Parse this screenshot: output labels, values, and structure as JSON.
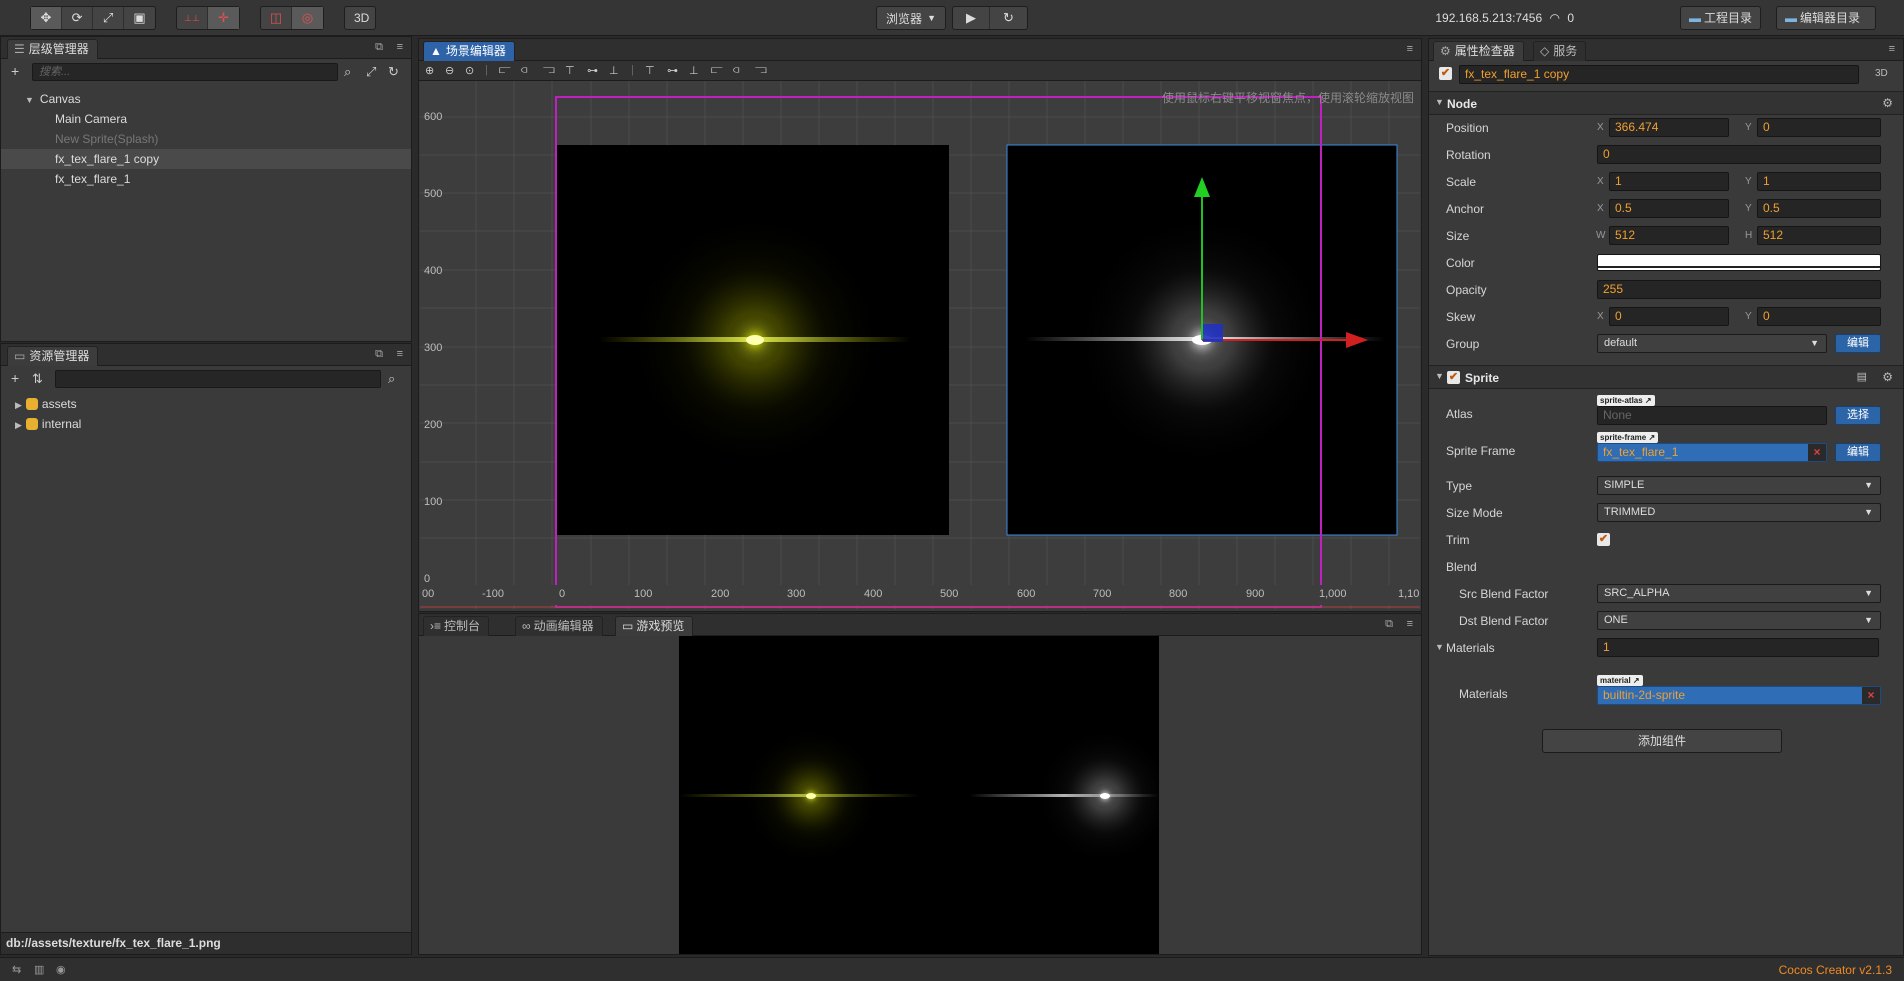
{
  "toolbar": {
    "transform_tools": [
      "move-tool-icon",
      "rotate-tool-icon",
      "scale-tool-icon",
      "rect-tool-icon"
    ],
    "gizmo_tools": [
      "pivot-icon",
      "world-local-icon"
    ],
    "snap_tools": [
      "snap-icon",
      "grid-icon"
    ],
    "mode_3d_label": "3D",
    "browser_select_label": "浏览器",
    "play_icon": "play-icon",
    "refresh_icon": "refresh-icon",
    "ip_address": "192.168.5.213:7456",
    "connections": "0",
    "project_dir_label": "工程目录",
    "editor_dir_label": "编辑器目录"
  },
  "hierarchy": {
    "tab_label": "层级管理器",
    "search_placeholder": "搜索...",
    "root": "Canvas",
    "items": [
      {
        "label": "Main Camera",
        "state": "normal"
      },
      {
        "label": "New Sprite(Splash)",
        "state": "inactive"
      },
      {
        "label": "fx_tex_flare_1 copy",
        "state": "selected"
      },
      {
        "label": "fx_tex_flare_1",
        "state": "normal"
      }
    ]
  },
  "assets": {
    "tab_label": "资源管理器",
    "search_placeholder": "",
    "items": [
      {
        "label": "assets"
      },
      {
        "label": "internal"
      }
    ],
    "footer_path": "db://assets/texture/fx_tex_flare_1.png"
  },
  "scene": {
    "tab_label": "场景编辑器",
    "hint": "使用鼠标右键平移视窗焦点，使用滚轮缩放视图",
    "y_ticks": [
      "600",
      "500",
      "400",
      "300",
      "200",
      "100",
      "0"
    ],
    "x_ticks": [
      "00",
      "-100",
      "0",
      "100",
      "200",
      "300",
      "400",
      "500",
      "600",
      "700",
      "800",
      "900",
      "1,000",
      "1,10"
    ]
  },
  "bottom_tabs": {
    "console": "控制台",
    "animation": "动画编辑器",
    "preview": "游戏预览"
  },
  "inspector": {
    "tab_label": "属性检查器",
    "services_tab": "服务",
    "node_name": "fx_tex_flare_1 copy",
    "mode_3d": "3D",
    "node_section": "Node",
    "position": {
      "label": "Position",
      "x": "366.474",
      "y": "0"
    },
    "rotation": {
      "label": "Rotation",
      "value": "0"
    },
    "scale": {
      "label": "Scale",
      "x": "1",
      "y": "1"
    },
    "anchor": {
      "label": "Anchor",
      "x": "0.5",
      "y": "0.5"
    },
    "size": {
      "label": "Size",
      "w": "512",
      "h": "512"
    },
    "color": {
      "label": "Color",
      "value": "#ffffff"
    },
    "opacity": {
      "label": "Opacity",
      "value": "255"
    },
    "skew": {
      "label": "Skew",
      "x": "0",
      "y": "0"
    },
    "group": {
      "label": "Group",
      "value": "default",
      "edit": "编辑"
    },
    "sprite_section": "Sprite",
    "atlas": {
      "label": "Atlas",
      "tag": "sprite-atlas",
      "value": "None",
      "button": "选择"
    },
    "sprite_frame": {
      "label": "Sprite Frame",
      "tag": "sprite-frame",
      "value": "fx_tex_flare_1",
      "button": "编辑"
    },
    "type": {
      "label": "Type",
      "value": "SIMPLE"
    },
    "size_mode": {
      "label": "Size Mode",
      "value": "TRIMMED"
    },
    "trim": {
      "label": "Trim"
    },
    "blend": {
      "label": "Blend"
    },
    "src_blend": {
      "label": "Src Blend Factor",
      "value": "SRC_ALPHA"
    },
    "dst_blend": {
      "label": "Dst Blend Factor",
      "value": "ONE"
    },
    "materials_header": {
      "label": "Materials",
      "value": "1"
    },
    "material": {
      "label": "Materials",
      "tag": "material",
      "value": "builtin-2d-sprite"
    },
    "add_component": "添加组件"
  },
  "status": {
    "version": "Cocos Creator v2.1.3"
  },
  "colors": {
    "accent_blue": "#2e63a8",
    "value_orange": "#f0a030",
    "version_orange": "#f08a24",
    "canvas_magenta": "#c020c0",
    "selection_blue": "#3b8de0"
  }
}
